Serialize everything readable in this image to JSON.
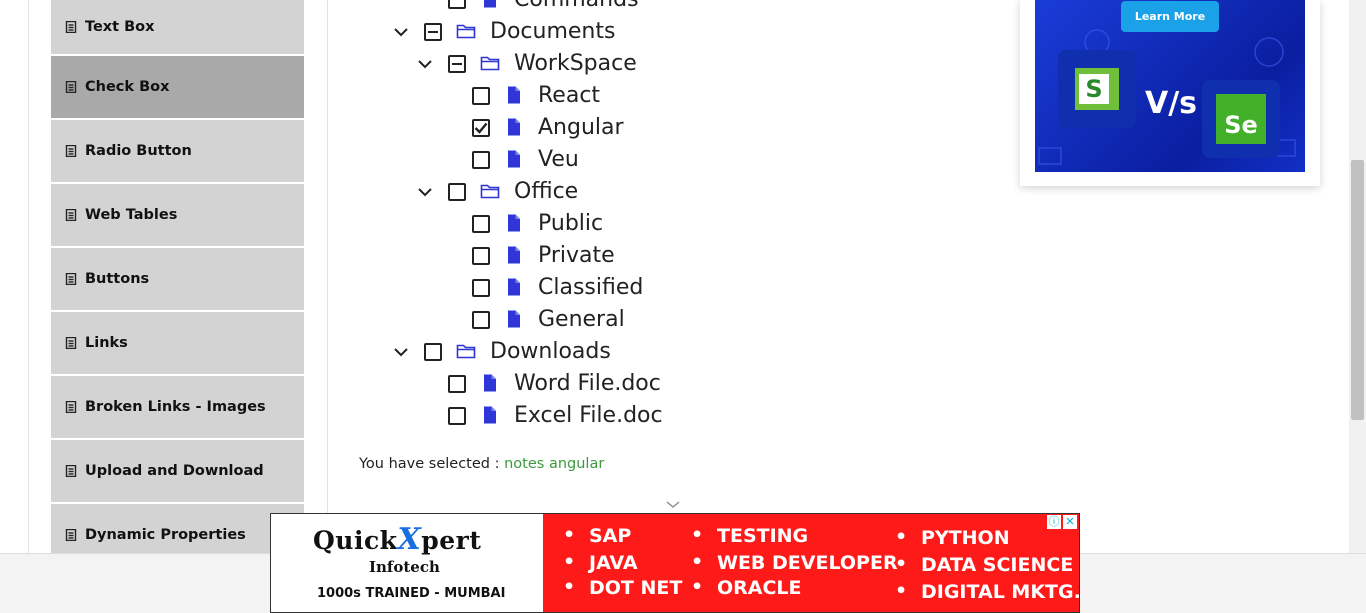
{
  "sidebar": {
    "items": [
      {
        "label": "Text Box"
      },
      {
        "label": "Check Box"
      },
      {
        "label": "Radio Button"
      },
      {
        "label": "Web Tables"
      },
      {
        "label": "Buttons"
      },
      {
        "label": "Links"
      },
      {
        "label": "Broken Links - Images"
      },
      {
        "label": "Upload and Download"
      },
      {
        "label": "Dynamic Properties"
      }
    ],
    "active_index": 1
  },
  "tree": {
    "nodes": [
      {
        "label": "Commands",
        "type": "file",
        "state": "unchecked",
        "expanded": null
      },
      {
        "label": "Documents",
        "type": "folder",
        "state": "partial",
        "expanded": true
      },
      {
        "label": "WorkSpace",
        "type": "folder",
        "state": "partial",
        "expanded": true
      },
      {
        "label": "React",
        "type": "file",
        "state": "unchecked",
        "expanded": null
      },
      {
        "label": "Angular",
        "type": "file",
        "state": "checked",
        "expanded": null
      },
      {
        "label": "Veu",
        "type": "file",
        "state": "unchecked",
        "expanded": null
      },
      {
        "label": "Office",
        "type": "folder",
        "state": "unchecked",
        "expanded": true
      },
      {
        "label": "Public",
        "type": "file",
        "state": "unchecked",
        "expanded": null
      },
      {
        "label": "Private",
        "type": "file",
        "state": "unchecked",
        "expanded": null
      },
      {
        "label": "Classified",
        "type": "file",
        "state": "unchecked",
        "expanded": null
      },
      {
        "label": "General",
        "type": "file",
        "state": "unchecked",
        "expanded": null
      },
      {
        "label": "Downloads",
        "type": "folder",
        "state": "unchecked",
        "expanded": true
      },
      {
        "label": "Word File.doc",
        "type": "file",
        "state": "unchecked",
        "expanded": null
      },
      {
        "label": "Excel File.doc",
        "type": "file",
        "state": "unchecked",
        "expanded": null
      }
    ]
  },
  "result": {
    "prefix": "You have selected :",
    "value": "notes angular"
  },
  "ad_top": {
    "button": "Learn More",
    "vs": "V/s",
    "logo_left": "S",
    "logo_right": "Se"
  },
  "ad_bottom": {
    "brand_quick": "Quick",
    "brand_x": "X",
    "brand_pert": "pert",
    "sub": "Infotech",
    "foot": "1000s TRAINED - MUMBAI",
    "courses": [
      "SAP",
      "JAVA",
      "DOT NET",
      "TESTING",
      "WEB DEVELOPER",
      "ORACLE",
      "PYTHON",
      "DATA SCIENCE",
      "DIGITAL MKTG."
    ],
    "info_icon": "ⓘ",
    "close_icon": "✕"
  },
  "colors": {
    "accent_blue": "#2f35d6",
    "selected_green": "#3c9a3c",
    "menu_bg": "#d3d3d3",
    "menu_active": "#a9a9a9",
    "ad_red": "#ff1a1a"
  }
}
